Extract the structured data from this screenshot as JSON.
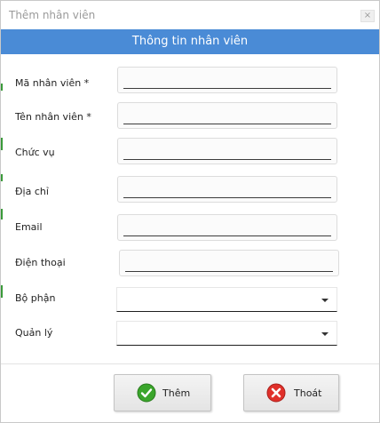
{
  "window": {
    "title": "Thêm nhân viên",
    "close_glyph": "×"
  },
  "header": {
    "title": "Thông tin nhân viên",
    "color": "#4a8bd6"
  },
  "form": {
    "employee_id_label": "Mã nhân viên  *",
    "employee_name_label": "Tên nhân viên *",
    "position_label": "Chức vụ",
    "address_label": "Địa chỉ",
    "email_label": "Email",
    "phone_label": "Điện thoại",
    "department_label": "Bộ phận",
    "manager_label": "Quản lý",
    "employee_id_value": "",
    "employee_name_value": "",
    "position_value": "",
    "address_value": "",
    "email_value": "",
    "phone_value": "",
    "department_value": "",
    "manager_value": ""
  },
  "buttons": {
    "add_label": "Thêm",
    "add_icon": "check-circle-icon",
    "exit_label": "Thoát",
    "exit_icon": "x-circle-icon"
  },
  "colors": {
    "add_icon": "#3aa52b",
    "exit_icon": "#e0302a"
  }
}
